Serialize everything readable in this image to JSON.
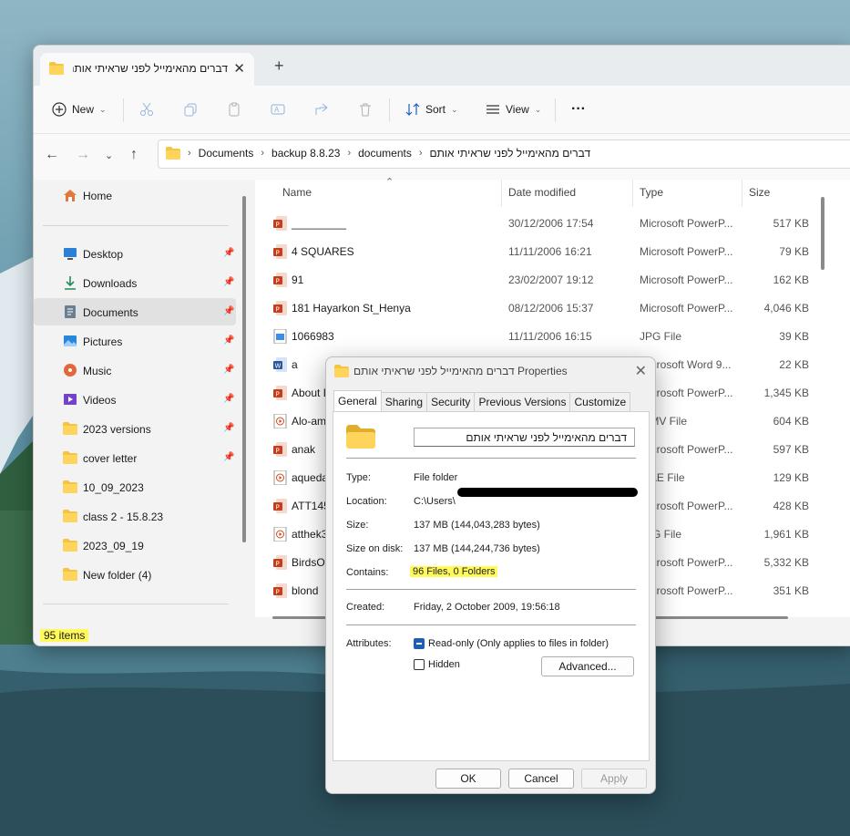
{
  "explorer": {
    "tab_title": "דברים מהאימייל לפני שראיתי אותם",
    "toolbar": {
      "new_label": "New",
      "sort_label": "Sort",
      "view_label": "View"
    },
    "breadcrumbs": [
      "Documents",
      "backup 8.8.23",
      "documents",
      "דברים מהאימייל לפני שראיתי אותם"
    ],
    "sidebar": {
      "home": "Home",
      "items": [
        {
          "label": "Desktop",
          "icon": "desktop-icon",
          "pinned": true
        },
        {
          "label": "Downloads",
          "icon": "download-icon",
          "pinned": true
        },
        {
          "label": "Documents",
          "icon": "document-icon",
          "pinned": true,
          "selected": true
        },
        {
          "label": "Pictures",
          "icon": "pictures-icon",
          "pinned": true
        },
        {
          "label": "Music",
          "icon": "music-icon",
          "pinned": true
        },
        {
          "label": "Videos",
          "icon": "videos-icon",
          "pinned": true
        },
        {
          "label": "2023 versions",
          "icon": "folder-icon",
          "pinned": true
        },
        {
          "label": "cover letter",
          "icon": "folder-icon",
          "pinned": true
        },
        {
          "label": "10_09_2023",
          "icon": "folder-icon",
          "pinned": false
        },
        {
          "label": "class 2 - 15.8.23",
          "icon": "folder-icon",
          "pinned": false
        },
        {
          "label": "2023_09_19",
          "icon": "folder-icon",
          "pinned": false
        },
        {
          "label": "New folder (4)",
          "icon": "folder-icon",
          "pinned": false
        }
      ]
    },
    "columns": {
      "name": "Name",
      "date": "Date modified",
      "type": "Type",
      "size": "Size"
    },
    "files": [
      {
        "name": "_________",
        "date": "30/12/2006 17:54",
        "type": "Microsoft PowerP...",
        "size": "517 KB",
        "icon": "ppt"
      },
      {
        "name": "4 SQUARES",
        "date": "11/11/2006 16:21",
        "type": "Microsoft PowerP...",
        "size": "79 KB",
        "icon": "ppt"
      },
      {
        "name": "91",
        "date": "23/02/2007 19:12",
        "type": "Microsoft PowerP...",
        "size": "162 KB",
        "icon": "ppt"
      },
      {
        "name": "181 Hayarkon St_Henya",
        "date": "08/12/2006 15:37",
        "type": "Microsoft PowerP...",
        "size": "4,046 KB",
        "icon": "ppt"
      },
      {
        "name": "1066983",
        "date": "11/11/2006 16:15",
        "type": "JPG File",
        "size": "39 KB",
        "icon": "jpg"
      },
      {
        "name": "a",
        "date": "",
        "type": "Microsoft Word 9...",
        "size": "22 KB",
        "icon": "word"
      },
      {
        "name": "About D",
        "date": "",
        "type": "Microsoft PowerP...",
        "size": "1,345 KB",
        "icon": "ppt"
      },
      {
        "name": "Alo-am",
        "date": "",
        "type": "WMV File",
        "size": "604 KB",
        "icon": "video"
      },
      {
        "name": "anak",
        "date": "",
        "type": "Microsoft PowerP...",
        "size": "597 KB",
        "icon": "ppt"
      },
      {
        "name": "aqueda",
        "date": "",
        "type": "WAE File",
        "size": "129 KB",
        "icon": "video"
      },
      {
        "name": "ATT1450",
        "date": "",
        "type": "Microsoft PowerP...",
        "size": "428 KB",
        "icon": "ppt"
      },
      {
        "name": "atthek3",
        "date": "",
        "type": "JPG File",
        "size": "1,961 KB",
        "icon": "video"
      },
      {
        "name": "BirdsOf",
        "date": "",
        "type": "Microsoft PowerP...",
        "size": "5,332 KB",
        "icon": "ppt"
      },
      {
        "name": "blond",
        "date": "",
        "type": "Microsoft PowerP...",
        "size": "351 KB",
        "icon": "ppt"
      }
    ],
    "status": "95 items"
  },
  "dialog": {
    "title": "דברים מהאימייל לפני שראיתי אותם Properties",
    "tabs": [
      "General",
      "Sharing",
      "Security",
      "Previous Versions",
      "Customize"
    ],
    "folder_name": "דברים מהאימייל לפני שראיתי אותם",
    "type_label": "Type:",
    "type_value": "File folder",
    "location_label": "Location:",
    "location_value": "C:\\Users\\",
    "size_label": "Size:",
    "size_value": "137 MB (144,043,283 bytes)",
    "size_on_disk_label": "Size on disk:",
    "size_on_disk_value": "137 MB (144,244,736 bytes)",
    "contains_label": "Contains:",
    "contains_value": "96 Files, 0 Folders",
    "created_label": "Created:",
    "created_value": "Friday, 2 October 2009, 19:56:18",
    "attributes_label": "Attributes:",
    "readonly_label": "Read-only (Only applies to files in folder)",
    "hidden_label": "Hidden",
    "advanced_label": "Advanced...",
    "ok_label": "OK",
    "cancel_label": "Cancel",
    "apply_label": "Apply"
  },
  "colors": {
    "highlight": "#fff95a",
    "accent": "#1c5fb5",
    "ppt": "#c43e1c",
    "folder": "#f4c542"
  }
}
